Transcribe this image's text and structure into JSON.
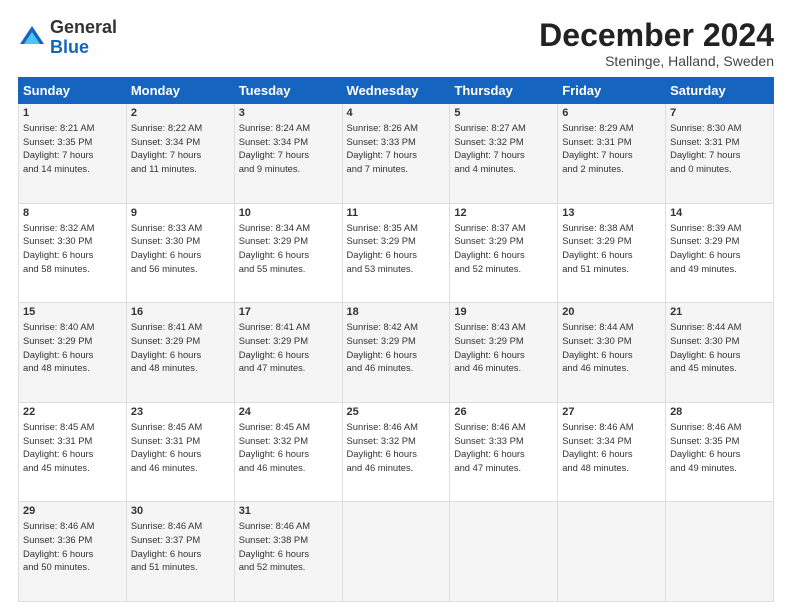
{
  "header": {
    "logo_general": "General",
    "logo_blue": "Blue",
    "month_title": "December 2024",
    "location": "Steninge, Halland, Sweden"
  },
  "days_of_week": [
    "Sunday",
    "Monday",
    "Tuesday",
    "Wednesday",
    "Thursday",
    "Friday",
    "Saturday"
  ],
  "weeks": [
    [
      {
        "day": "1",
        "detail": "Sunrise: 8:21 AM\nSunset: 3:35 PM\nDaylight: 7 hours\nand 14 minutes."
      },
      {
        "day": "2",
        "detail": "Sunrise: 8:22 AM\nSunset: 3:34 PM\nDaylight: 7 hours\nand 11 minutes."
      },
      {
        "day": "3",
        "detail": "Sunrise: 8:24 AM\nSunset: 3:34 PM\nDaylight: 7 hours\nand 9 minutes."
      },
      {
        "day": "4",
        "detail": "Sunrise: 8:26 AM\nSunset: 3:33 PM\nDaylight: 7 hours\nand 7 minutes."
      },
      {
        "day": "5",
        "detail": "Sunrise: 8:27 AM\nSunset: 3:32 PM\nDaylight: 7 hours\nand 4 minutes."
      },
      {
        "day": "6",
        "detail": "Sunrise: 8:29 AM\nSunset: 3:31 PM\nDaylight: 7 hours\nand 2 minutes."
      },
      {
        "day": "7",
        "detail": "Sunrise: 8:30 AM\nSunset: 3:31 PM\nDaylight: 7 hours\nand 0 minutes."
      }
    ],
    [
      {
        "day": "8",
        "detail": "Sunrise: 8:32 AM\nSunset: 3:30 PM\nDaylight: 6 hours\nand 58 minutes."
      },
      {
        "day": "9",
        "detail": "Sunrise: 8:33 AM\nSunset: 3:30 PM\nDaylight: 6 hours\nand 56 minutes."
      },
      {
        "day": "10",
        "detail": "Sunrise: 8:34 AM\nSunset: 3:29 PM\nDaylight: 6 hours\nand 55 minutes."
      },
      {
        "day": "11",
        "detail": "Sunrise: 8:35 AM\nSunset: 3:29 PM\nDaylight: 6 hours\nand 53 minutes."
      },
      {
        "day": "12",
        "detail": "Sunrise: 8:37 AM\nSunset: 3:29 PM\nDaylight: 6 hours\nand 52 minutes."
      },
      {
        "day": "13",
        "detail": "Sunrise: 8:38 AM\nSunset: 3:29 PM\nDaylight: 6 hours\nand 51 minutes."
      },
      {
        "day": "14",
        "detail": "Sunrise: 8:39 AM\nSunset: 3:29 PM\nDaylight: 6 hours\nand 49 minutes."
      }
    ],
    [
      {
        "day": "15",
        "detail": "Sunrise: 8:40 AM\nSunset: 3:29 PM\nDaylight: 6 hours\nand 48 minutes."
      },
      {
        "day": "16",
        "detail": "Sunrise: 8:41 AM\nSunset: 3:29 PM\nDaylight: 6 hours\nand 48 minutes."
      },
      {
        "day": "17",
        "detail": "Sunrise: 8:41 AM\nSunset: 3:29 PM\nDaylight: 6 hours\nand 47 minutes."
      },
      {
        "day": "18",
        "detail": "Sunrise: 8:42 AM\nSunset: 3:29 PM\nDaylight: 6 hours\nand 46 minutes."
      },
      {
        "day": "19",
        "detail": "Sunrise: 8:43 AM\nSunset: 3:29 PM\nDaylight: 6 hours\nand 46 minutes."
      },
      {
        "day": "20",
        "detail": "Sunrise: 8:44 AM\nSunset: 3:30 PM\nDaylight: 6 hours\nand 46 minutes."
      },
      {
        "day": "21",
        "detail": "Sunrise: 8:44 AM\nSunset: 3:30 PM\nDaylight: 6 hours\nand 45 minutes."
      }
    ],
    [
      {
        "day": "22",
        "detail": "Sunrise: 8:45 AM\nSunset: 3:31 PM\nDaylight: 6 hours\nand 45 minutes."
      },
      {
        "day": "23",
        "detail": "Sunrise: 8:45 AM\nSunset: 3:31 PM\nDaylight: 6 hours\nand 46 minutes."
      },
      {
        "day": "24",
        "detail": "Sunrise: 8:45 AM\nSunset: 3:32 PM\nDaylight: 6 hours\nand 46 minutes."
      },
      {
        "day": "25",
        "detail": "Sunrise: 8:46 AM\nSunset: 3:32 PM\nDaylight: 6 hours\nand 46 minutes."
      },
      {
        "day": "26",
        "detail": "Sunrise: 8:46 AM\nSunset: 3:33 PM\nDaylight: 6 hours\nand 47 minutes."
      },
      {
        "day": "27",
        "detail": "Sunrise: 8:46 AM\nSunset: 3:34 PM\nDaylight: 6 hours\nand 48 minutes."
      },
      {
        "day": "28",
        "detail": "Sunrise: 8:46 AM\nSunset: 3:35 PM\nDaylight: 6 hours\nand 49 minutes."
      }
    ],
    [
      {
        "day": "29",
        "detail": "Sunrise: 8:46 AM\nSunset: 3:36 PM\nDaylight: 6 hours\nand 50 minutes."
      },
      {
        "day": "30",
        "detail": "Sunrise: 8:46 AM\nSunset: 3:37 PM\nDaylight: 6 hours\nand 51 minutes."
      },
      {
        "day": "31",
        "detail": "Sunrise: 8:46 AM\nSunset: 3:38 PM\nDaylight: 6 hours\nand 52 minutes."
      },
      {
        "day": "",
        "detail": ""
      },
      {
        "day": "",
        "detail": ""
      },
      {
        "day": "",
        "detail": ""
      },
      {
        "day": "",
        "detail": ""
      }
    ]
  ]
}
